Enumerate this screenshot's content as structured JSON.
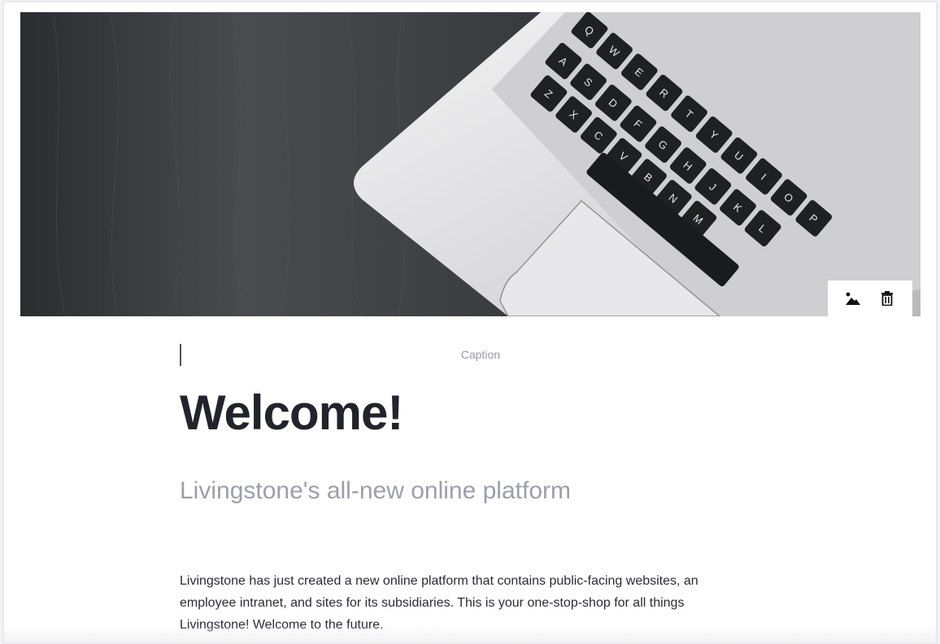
{
  "hero": {
    "keyboard_keys": [
      "Q",
      "W",
      "E",
      "R",
      "T",
      "Y",
      "U",
      "I",
      "O",
      "P",
      "A",
      "S",
      "D",
      "F",
      "G",
      "H",
      "J",
      "K",
      "L",
      "Z",
      "X",
      "C",
      "V",
      "B",
      "N",
      "M"
    ],
    "toolbar": {
      "change_image_icon": "image-icon",
      "delete_icon": "trash-icon"
    }
  },
  "caption": {
    "placeholder": "Caption"
  },
  "title": "Welcome!",
  "subtitle": "Livingstone's all-new online platform",
  "body": "Livingstone has just created a new online platform that contains public-facing websites, an employee intranet, and sites for its subsidiaries. This is your one-stop-shop for all things Livingstone! Welcome to the future.",
  "colors": {
    "title": "#23232b",
    "subtitle": "#9d9eaa",
    "caption": "#9a9ba3",
    "body": "#2b2b33"
  }
}
